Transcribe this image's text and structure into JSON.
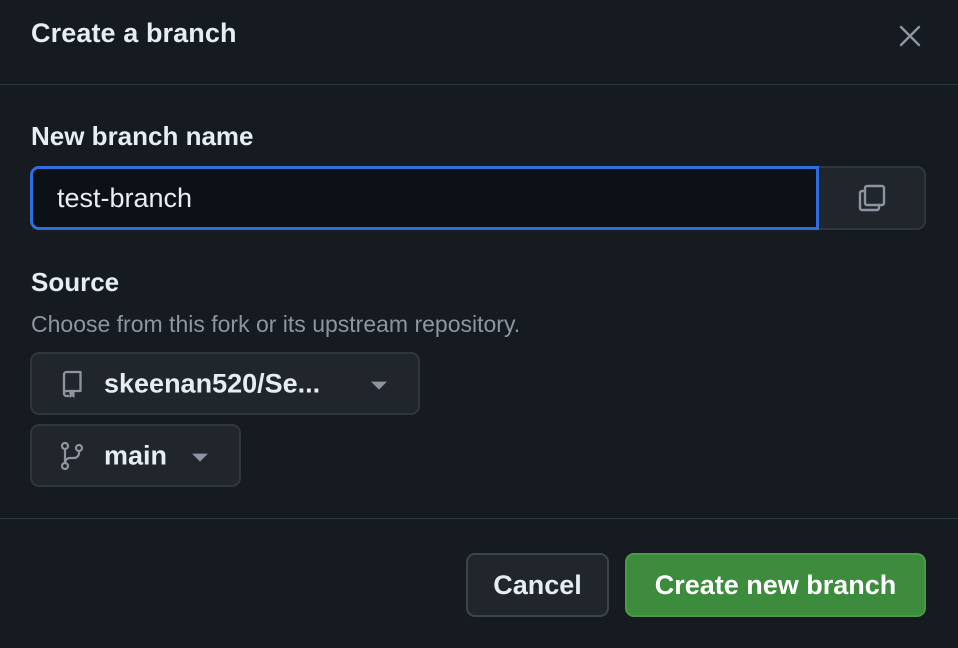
{
  "dialog": {
    "title": "Create a branch"
  },
  "branch_name": {
    "label": "New branch name",
    "value": "test-branch"
  },
  "source": {
    "label": "Source",
    "hint": "Choose from this fork or its upstream repository.",
    "repository": "skeenan520/Se...",
    "branch": "main"
  },
  "footer": {
    "cancel_label": "Cancel",
    "create_label": "Create new branch"
  },
  "icons": {
    "close": "close-icon",
    "copy": "copy-icon",
    "repo": "repo-icon",
    "branch": "git-branch-icon",
    "caret": "triangle-down-icon"
  },
  "colors": {
    "background": "#161b22",
    "focus_border": "#2f6fdd",
    "primary_button": "#3d8b3d",
    "muted_text": "#8d96a0"
  }
}
